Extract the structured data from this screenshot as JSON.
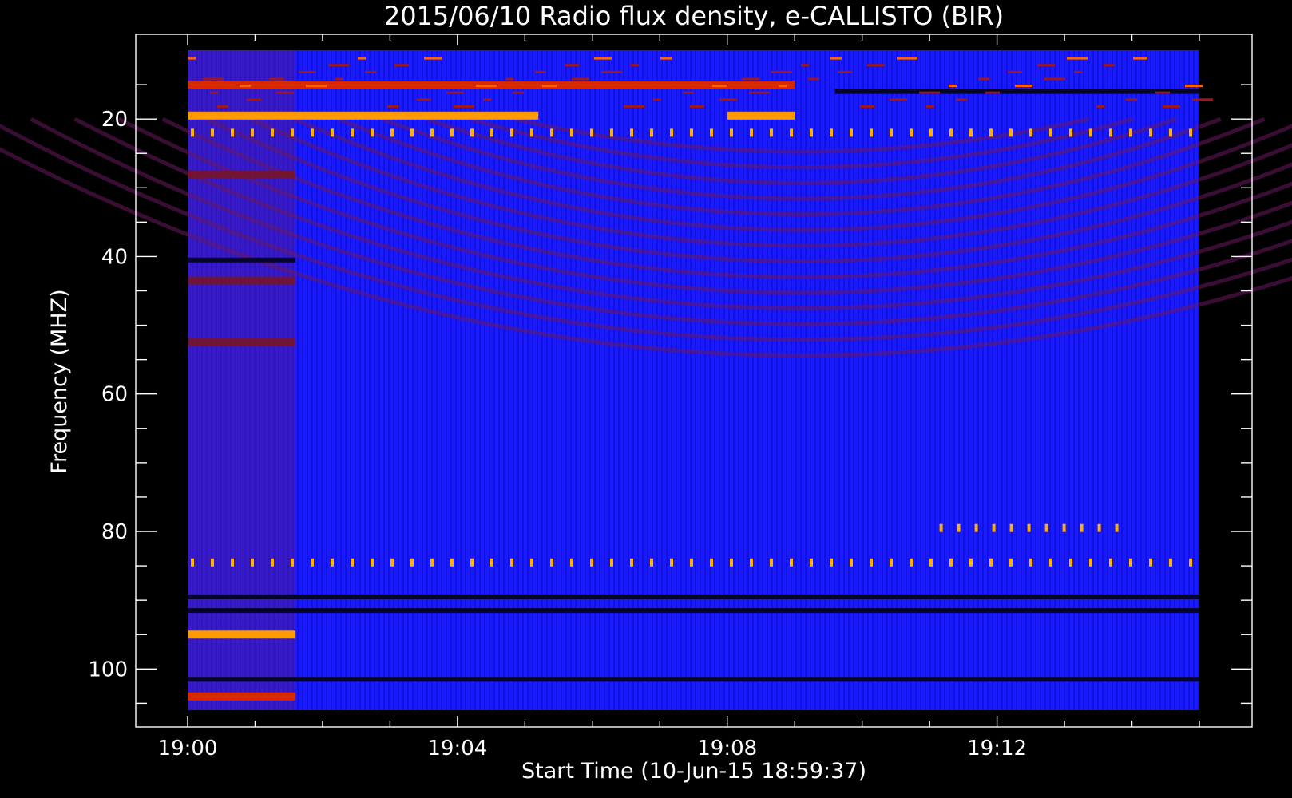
{
  "chart_data": {
    "type": "heatmap",
    "title": "2015/06/10  Radio flux density, e-CALLISTO (BIR)",
    "xlabel": "Start Time (10-Jun-15 18:59:37)",
    "ylabel": "Frequency (MHZ)",
    "x_range": [
      "19:00",
      "19:15"
    ],
    "ylim": [
      10,
      106
    ],
    "y_axis": "inverted",
    "x_ticks": [
      "19:00",
      "19:04",
      "19:08",
      "19:12"
    ],
    "y_ticks": [
      20,
      40,
      60,
      80,
      100
    ],
    "colormap": [
      "#000000",
      "#0000ff",
      "#7a1420",
      "#ff3000",
      "#ffa000",
      "#ffff40"
    ],
    "background_level": "blue",
    "bands": [
      {
        "freq": 15,
        "start": "19:00",
        "end": "19:09",
        "level": "red"
      },
      {
        "freq": 19.5,
        "start": "19:00",
        "end": "19:05.2",
        "level": "orange"
      },
      {
        "freq": 19.5,
        "start": "19:08",
        "end": "19:09",
        "level": "orange"
      },
      {
        "freq": 16,
        "start": "19:09.6",
        "end": "19:15",
        "level": "black"
      },
      {
        "freq": 22,
        "start": "19:00",
        "end": "19:15",
        "level": "spikes"
      },
      {
        "freq": 28,
        "start": "19:00",
        "end": "19:01.6",
        "level": "dark-red"
      },
      {
        "freq": 40.5,
        "start": "19:00",
        "end": "19:01.6",
        "level": "black"
      },
      {
        "freq": 43.5,
        "start": "19:00",
        "end": "19:01.6",
        "level": "dark-red"
      },
      {
        "freq": 52.5,
        "start": "19:00",
        "end": "19:01.6",
        "level": "dark-red"
      },
      {
        "freq": 79.5,
        "start": "19:11.1",
        "end": "19:13.8",
        "level": "spikes"
      },
      {
        "freq": 84.5,
        "start": "19:00",
        "end": "19:15",
        "level": "spikes"
      },
      {
        "freq": 89.5,
        "start": "19:00",
        "end": "19:15",
        "level": "black"
      },
      {
        "freq": 91.5,
        "start": "19:00",
        "end": "19:15",
        "level": "black"
      },
      {
        "freq": 95,
        "start": "19:00",
        "end": "19:01.6",
        "level": "orange"
      },
      {
        "freq": 101.5,
        "start": "19:00",
        "end": "19:15",
        "level": "black"
      },
      {
        "freq": 104,
        "start": "19:00",
        "end": "19:01.6",
        "level": "red"
      }
    ],
    "grid": false,
    "legend": "none"
  },
  "colors": {
    "background": "#000000",
    "axes": "#ffffff",
    "spectrum_base": "#1a1aff"
  }
}
